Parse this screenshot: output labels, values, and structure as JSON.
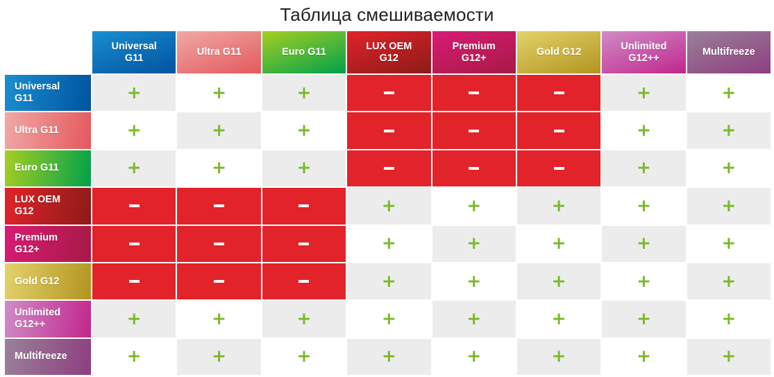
{
  "title": "Таблица смешиваемости",
  "legend": {
    "compatible_symbol": "+",
    "incompatible_symbol": "−",
    "compatible_color": "#7ab828",
    "incompatible_color": "#e2232a",
    "cell_shade_a": "#ececec",
    "cell_shade_b": "#ffffff"
  },
  "products": [
    {
      "id": "universal-g11",
      "label": "Universal\nG11",
      "gradient_from": "#1b8fd0",
      "gradient_to": "#00539f"
    },
    {
      "id": "ultra-g11",
      "label": "Ultra G11",
      "gradient_from": "#f0a9a6",
      "gradient_to": "#e4585c"
    },
    {
      "id": "euro-g11",
      "label": "Euro G11",
      "gradient_from": "#a6ce22",
      "gradient_to": "#00a14b"
    },
    {
      "id": "lux-oem-g12",
      "label": "LUX OEM\nG12",
      "gradient_from": "#e2232a",
      "gradient_to": "#8c1b18"
    },
    {
      "id": "premium-g12-plus",
      "label": "Premium\nG12+",
      "gradient_from": "#d81b75",
      "gradient_to": "#a81a45"
    },
    {
      "id": "gold-g12",
      "label": "Gold G12",
      "gradient_from": "#e3d36c",
      "gradient_to": "#b2941f"
    },
    {
      "id": "unlimited-g12-plusplus",
      "label": "Unlimited\nG12++",
      "gradient_from": "#cf8cc6",
      "gradient_to": "#c2268e"
    },
    {
      "id": "multifreeze",
      "label": "Multifreeze",
      "gradient_from": "#9a8099",
      "gradient_to": "#8e3f80"
    }
  ],
  "column_headers": [
    "Universal\nG11",
    "Ultra G11",
    "Euro G11",
    "LUX OEM\nG12",
    "Premium\nG12+",
    "Gold G12",
    "Unlimited\nG12++",
    "Multifreeze"
  ],
  "row_headers": [
    "Universal\nG11",
    "Ultra G11",
    "Euro G11",
    "LUX OEM\nG12",
    "Premium\nG12+",
    "Gold G12",
    "Unlimited\nG12++",
    "Multifreeze"
  ],
  "chart_data": {
    "type": "heatmap",
    "title": "Таблица смешиваемости",
    "xlabel": "",
    "ylabel": "",
    "categories": [
      "Universal G11",
      "Ultra G11",
      "Euro G11",
      "LUX OEM G12",
      "Premium G12+",
      "Gold G12",
      "Unlimited G12++",
      "Multifreeze"
    ],
    "value_legend": {
      "+": "compatible",
      "−": "incompatible"
    },
    "matrix": [
      [
        "+",
        "+",
        "+",
        "−",
        "−",
        "−",
        "+",
        "+"
      ],
      [
        "+",
        "+",
        "+",
        "−",
        "−",
        "−",
        "+",
        "+"
      ],
      [
        "+",
        "+",
        "+",
        "−",
        "−",
        "−",
        "+",
        "+"
      ],
      [
        "−",
        "−",
        "−",
        "+",
        "+",
        "+",
        "+",
        "+"
      ],
      [
        "−",
        "−",
        "−",
        "+",
        "+",
        "+",
        "+",
        "+"
      ],
      [
        "−",
        "−",
        "−",
        "+",
        "+",
        "+",
        "+",
        "+"
      ],
      [
        "+",
        "+",
        "+",
        "+",
        "+",
        "+",
        "+",
        "+"
      ],
      [
        "+",
        "+",
        "+",
        "+",
        "+",
        "+",
        "+",
        "+"
      ]
    ]
  }
}
